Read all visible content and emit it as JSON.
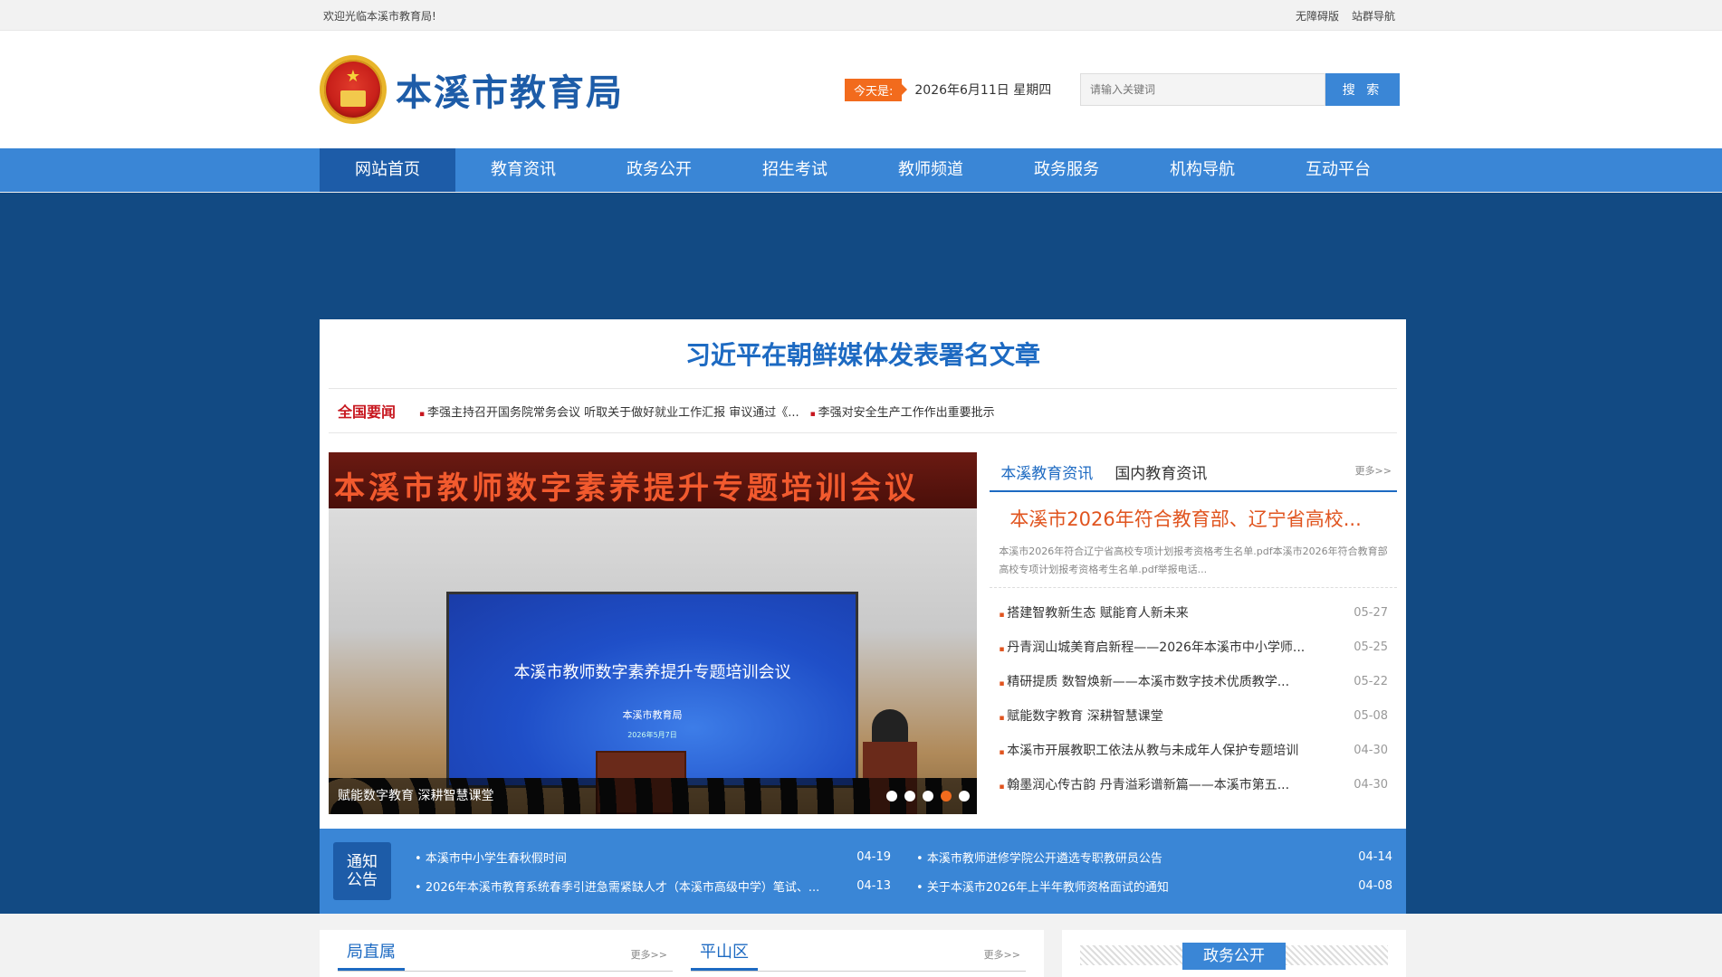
{
  "topbar": {
    "welcome": "欢迎光临本溪市教育局!",
    "links": [
      "无障碍版",
      "站群导航"
    ]
  },
  "header": {
    "site_title": "本溪市教育局",
    "today_label": "今天是:",
    "date": "2026年6月11日 星期四",
    "search_placeholder": "请输入关键词",
    "search_button": "搜 索"
  },
  "nav": [
    "网站首页",
    "教育资讯",
    "政务公开",
    "招生考试",
    "教师频道",
    "政务服务",
    "机构导航",
    "互动平台"
  ],
  "headline": "习近平在朝鲜媒体发表署名文章",
  "national_news": {
    "label": "全国要闻",
    "items": [
      "李强主持召开国务院常务会议 听取关于做好就业工作汇报 审议通过《...",
      "李强对安全生产工作作出重要批示"
    ]
  },
  "slider": {
    "banner_text": "本溪市教师数字素养提升专题培训会议",
    "screen_title": "本溪市教师数字素养提升专题培训会议",
    "screen_sub": "本溪市教育局",
    "screen_date": "2026年5月7日",
    "caption": "赋能数字教育 深耕智慧课堂",
    "active_dot": 3
  },
  "news_tabs": {
    "tabs": [
      "本溪教育资讯",
      "国内教育资讯"
    ],
    "more": "更多>>",
    "feature_title": "本溪市2026年符合教育部、辽宁省高校...",
    "feature_desc": "本溪市2026年符合辽宁省高校专项计划报考资格考生名单.pdf本溪市2026年符合教育部高校专项计划报考资格考生名单.pdf举报电话...",
    "items": [
      {
        "title": "搭建智教新生态 赋能育人新未来",
        "date": "05-27"
      },
      {
        "title": "丹青润山城美育启新程——2026年本溪市中小学师...",
        "date": "05-25"
      },
      {
        "title": "精研提质 数智焕新——本溪市数字技术优质教学...",
        "date": "05-22"
      },
      {
        "title": "赋能数字教育 深耕智慧课堂",
        "date": "05-08"
      },
      {
        "title": "本溪市开展教职工依法从教与未成年人保护专题培训",
        "date": "04-30"
      },
      {
        "title": "翰墨润心传古韵 丹青溢彩谱新篇——本溪市第五...",
        "date": "04-30"
      }
    ]
  },
  "notice": {
    "label_line1": "通知",
    "label_line2": "公告",
    "left": [
      {
        "title": "本溪市中小学生春秋假时间",
        "date": "04-19"
      },
      {
        "title": "2026年本溪市教育系统春季引进急需紧缺人才（本溪市高级中学）笔试、...",
        "date": "04-13"
      }
    ],
    "right": [
      {
        "title": "本溪市教师进修学院公开遴选专职教研员公告",
        "date": "04-14"
      },
      {
        "title": "关于本溪市2026年上半年教师资格面试的通知",
        "date": "04-08"
      }
    ]
  },
  "bottom": {
    "col1_title": "局直属",
    "col2_title": "平山区",
    "more": "更多>>",
    "gov_title": "政务公开"
  }
}
